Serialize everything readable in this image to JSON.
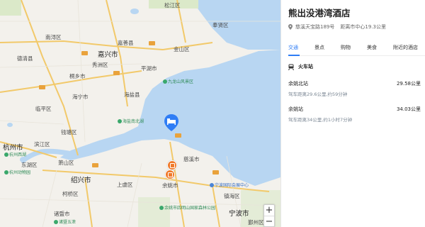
{
  "map": {
    "cities": [
      {
        "name": "松江区",
        "cls": "city"
      },
      {
        "name": "南浔区",
        "cls": "city"
      },
      {
        "name": "奉贤区",
        "cls": "city"
      },
      {
        "name": "嘉善县",
        "cls": "city"
      },
      {
        "name": "嘉兴市",
        "cls": "city big"
      },
      {
        "name": "金山区",
        "cls": "city"
      },
      {
        "name": "平湖市",
        "cls": "city"
      },
      {
        "name": "德清县",
        "cls": "city"
      },
      {
        "name": "桐乡市",
        "cls": "city"
      },
      {
        "name": "海盐县",
        "cls": "city"
      },
      {
        "name": "海宁市",
        "cls": "city"
      },
      {
        "name": "钱塘区",
        "cls": "city"
      },
      {
        "name": "杭州市",
        "cls": "city big"
      },
      {
        "name": "滨江区",
        "cls": "city"
      },
      {
        "name": "萧山区",
        "cls": "city"
      },
      {
        "name": "绍兴市",
        "cls": "city big"
      },
      {
        "name": "上虞区",
        "cls": "city"
      },
      {
        "name": "诸暨市",
        "cls": "city"
      },
      {
        "name": "慈溪市",
        "cls": "city"
      },
      {
        "name": "余姚市",
        "cls": "city"
      },
      {
        "name": "镇海区",
        "cls": "city"
      },
      {
        "name": "宁波市",
        "cls": "city big"
      },
      {
        "name": "鄞州区",
        "cls": "city"
      },
      {
        "name": "东湖区",
        "cls": "city"
      },
      {
        "name": "柯桥区",
        "cls": "city"
      },
      {
        "name": "临平区",
        "cls": "city"
      },
      {
        "name": "秀洲区",
        "cls": "city"
      }
    ],
    "pois": [
      {
        "name": "九龙山风景区",
        "cls": "poi"
      },
      {
        "name": "海盐南北湖",
        "cls": "poi"
      },
      {
        "name": "杭州西湖",
        "cls": "poi"
      },
      {
        "name": "杭州动物园",
        "cls": "poi"
      },
      {
        "name": "诸暨五泄",
        "cls": "poi"
      },
      {
        "name": "余姚市四明山国家森林公园",
        "cls": "poi"
      },
      {
        "name": "宁波国际会展中心",
        "cls": "poi blue"
      }
    ],
    "zoom_in": "+",
    "zoom_out": "−"
  },
  "panel": {
    "hotel_name": "熊出没港湾酒店",
    "address": "慈溪天宝路189号",
    "distance": "距离市中心19.3公里",
    "tabs": [
      "交通",
      "景点",
      "购物",
      "美食",
      "附近的酒店"
    ],
    "section_title": "火车站",
    "stations": [
      {
        "name": "余姚北站",
        "distance": "29.58公里",
        "drive": "驾车距离29.6公里,约59分钟"
      },
      {
        "name": "余姚站",
        "distance": "34.03公里",
        "drive": "驾车距离34公里,约1小时7分钟"
      }
    ]
  },
  "colors": {
    "water": "#b8d6f2",
    "land": "#f3f1ec",
    "accent": "#2f7df5",
    "pin": "#2f7df5",
    "train": "#f07a2b"
  }
}
